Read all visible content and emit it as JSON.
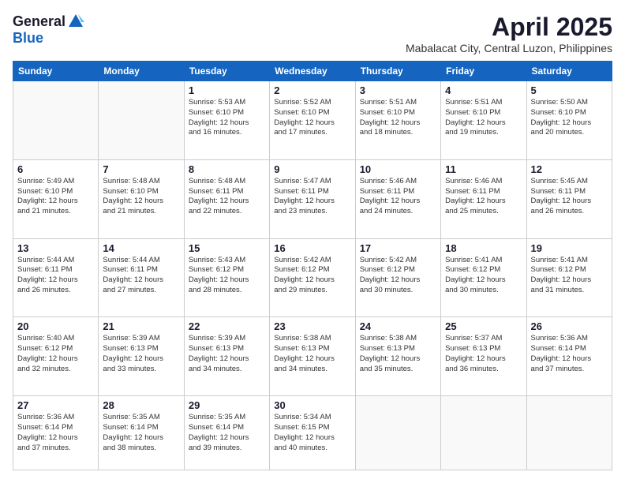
{
  "logo": {
    "general": "General",
    "blue": "Blue"
  },
  "header": {
    "month": "April 2025",
    "location": "Mabalacat City, Central Luzon, Philippines"
  },
  "weekdays": [
    "Sunday",
    "Monday",
    "Tuesday",
    "Wednesday",
    "Thursday",
    "Friday",
    "Saturday"
  ],
  "weeks": [
    [
      {
        "day": "",
        "info": ""
      },
      {
        "day": "",
        "info": ""
      },
      {
        "day": "1",
        "info": "Sunrise: 5:53 AM\nSunset: 6:10 PM\nDaylight: 12 hours\nand 16 minutes."
      },
      {
        "day": "2",
        "info": "Sunrise: 5:52 AM\nSunset: 6:10 PM\nDaylight: 12 hours\nand 17 minutes."
      },
      {
        "day": "3",
        "info": "Sunrise: 5:51 AM\nSunset: 6:10 PM\nDaylight: 12 hours\nand 18 minutes."
      },
      {
        "day": "4",
        "info": "Sunrise: 5:51 AM\nSunset: 6:10 PM\nDaylight: 12 hours\nand 19 minutes."
      },
      {
        "day": "5",
        "info": "Sunrise: 5:50 AM\nSunset: 6:10 PM\nDaylight: 12 hours\nand 20 minutes."
      }
    ],
    [
      {
        "day": "6",
        "info": "Sunrise: 5:49 AM\nSunset: 6:10 PM\nDaylight: 12 hours\nand 21 minutes."
      },
      {
        "day": "7",
        "info": "Sunrise: 5:48 AM\nSunset: 6:10 PM\nDaylight: 12 hours\nand 21 minutes."
      },
      {
        "day": "8",
        "info": "Sunrise: 5:48 AM\nSunset: 6:11 PM\nDaylight: 12 hours\nand 22 minutes."
      },
      {
        "day": "9",
        "info": "Sunrise: 5:47 AM\nSunset: 6:11 PM\nDaylight: 12 hours\nand 23 minutes."
      },
      {
        "day": "10",
        "info": "Sunrise: 5:46 AM\nSunset: 6:11 PM\nDaylight: 12 hours\nand 24 minutes."
      },
      {
        "day": "11",
        "info": "Sunrise: 5:46 AM\nSunset: 6:11 PM\nDaylight: 12 hours\nand 25 minutes."
      },
      {
        "day": "12",
        "info": "Sunrise: 5:45 AM\nSunset: 6:11 PM\nDaylight: 12 hours\nand 26 minutes."
      }
    ],
    [
      {
        "day": "13",
        "info": "Sunrise: 5:44 AM\nSunset: 6:11 PM\nDaylight: 12 hours\nand 26 minutes."
      },
      {
        "day": "14",
        "info": "Sunrise: 5:44 AM\nSunset: 6:11 PM\nDaylight: 12 hours\nand 27 minutes."
      },
      {
        "day": "15",
        "info": "Sunrise: 5:43 AM\nSunset: 6:12 PM\nDaylight: 12 hours\nand 28 minutes."
      },
      {
        "day": "16",
        "info": "Sunrise: 5:42 AM\nSunset: 6:12 PM\nDaylight: 12 hours\nand 29 minutes."
      },
      {
        "day": "17",
        "info": "Sunrise: 5:42 AM\nSunset: 6:12 PM\nDaylight: 12 hours\nand 30 minutes."
      },
      {
        "day": "18",
        "info": "Sunrise: 5:41 AM\nSunset: 6:12 PM\nDaylight: 12 hours\nand 30 minutes."
      },
      {
        "day": "19",
        "info": "Sunrise: 5:41 AM\nSunset: 6:12 PM\nDaylight: 12 hours\nand 31 minutes."
      }
    ],
    [
      {
        "day": "20",
        "info": "Sunrise: 5:40 AM\nSunset: 6:12 PM\nDaylight: 12 hours\nand 32 minutes."
      },
      {
        "day": "21",
        "info": "Sunrise: 5:39 AM\nSunset: 6:13 PM\nDaylight: 12 hours\nand 33 minutes."
      },
      {
        "day": "22",
        "info": "Sunrise: 5:39 AM\nSunset: 6:13 PM\nDaylight: 12 hours\nand 34 minutes."
      },
      {
        "day": "23",
        "info": "Sunrise: 5:38 AM\nSunset: 6:13 PM\nDaylight: 12 hours\nand 34 minutes."
      },
      {
        "day": "24",
        "info": "Sunrise: 5:38 AM\nSunset: 6:13 PM\nDaylight: 12 hours\nand 35 minutes."
      },
      {
        "day": "25",
        "info": "Sunrise: 5:37 AM\nSunset: 6:13 PM\nDaylight: 12 hours\nand 36 minutes."
      },
      {
        "day": "26",
        "info": "Sunrise: 5:36 AM\nSunset: 6:14 PM\nDaylight: 12 hours\nand 37 minutes."
      }
    ],
    [
      {
        "day": "27",
        "info": "Sunrise: 5:36 AM\nSunset: 6:14 PM\nDaylight: 12 hours\nand 37 minutes."
      },
      {
        "day": "28",
        "info": "Sunrise: 5:35 AM\nSunset: 6:14 PM\nDaylight: 12 hours\nand 38 minutes."
      },
      {
        "day": "29",
        "info": "Sunrise: 5:35 AM\nSunset: 6:14 PM\nDaylight: 12 hours\nand 39 minutes."
      },
      {
        "day": "30",
        "info": "Sunrise: 5:34 AM\nSunset: 6:15 PM\nDaylight: 12 hours\nand 40 minutes."
      },
      {
        "day": "",
        "info": ""
      },
      {
        "day": "",
        "info": ""
      },
      {
        "day": "",
        "info": ""
      }
    ]
  ]
}
